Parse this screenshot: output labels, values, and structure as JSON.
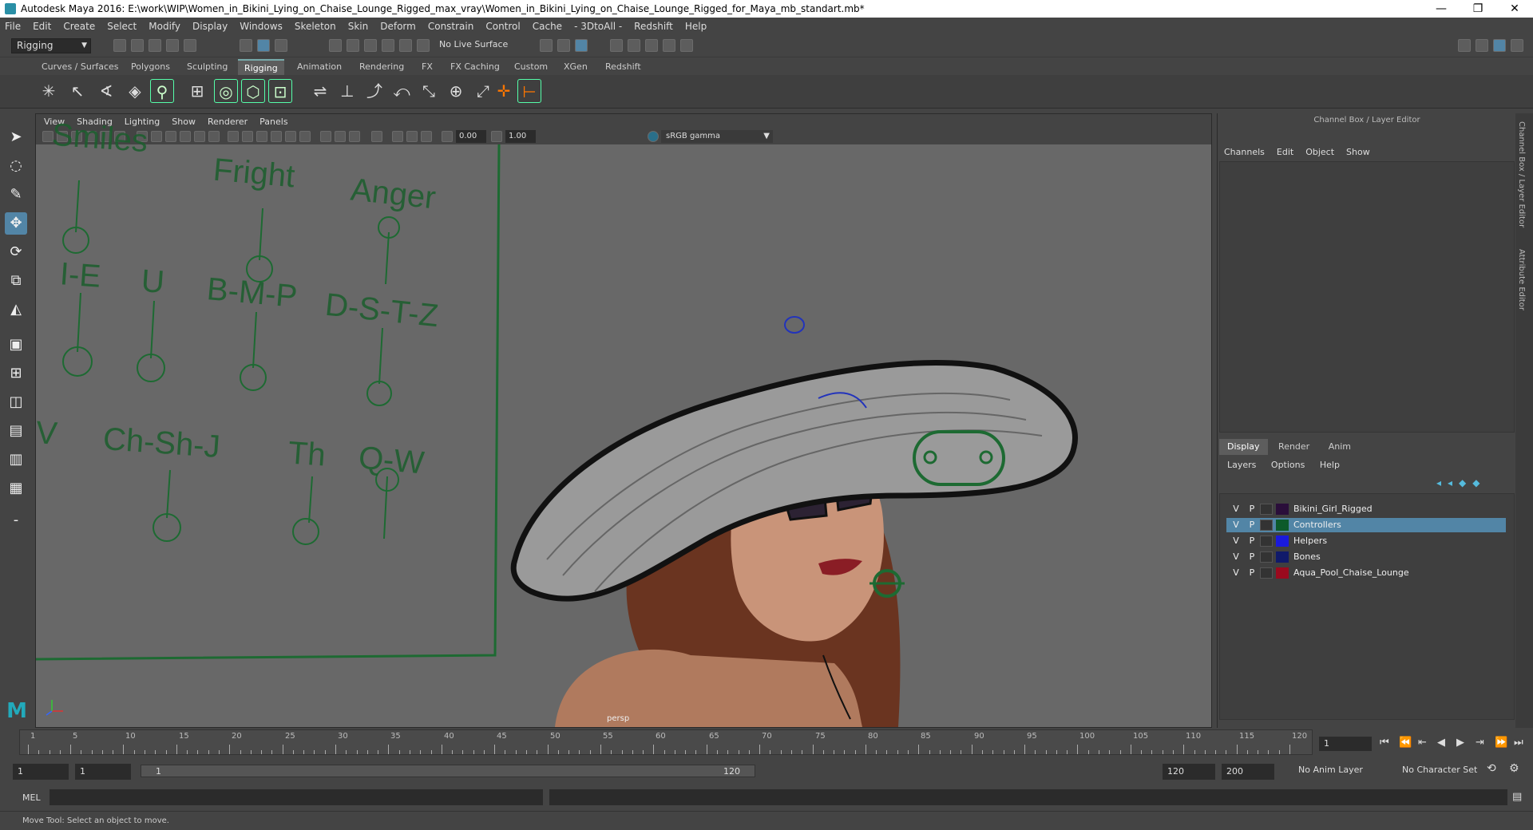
{
  "window": {
    "title": "Autodesk Maya 2016: E:\\work\\WIP\\Women_in_Bikini_Lying_on_Chaise_Lounge_Rigged_max_vray\\Women_in_Bikini_Lying_on_Chaise_Lounge_Rigged_for_Maya_mb_standart.mb*",
    "minimize": "—",
    "restore": "❐",
    "close": "✕"
  },
  "menubar": [
    "File",
    "Edit",
    "Create",
    "Select",
    "Modify",
    "Display",
    "Windows",
    "Skeleton",
    "Skin",
    "Deform",
    "Constrain",
    "Control",
    "Cache",
    "- 3DtoAll -",
    "Redshift",
    "Help"
  ],
  "statusline": {
    "mode": "Rigging",
    "live_surface": "No Live Surface"
  },
  "shelf_tabs": [
    "Curves / Surfaces",
    "Polygons",
    "Sculpting",
    "Rigging",
    "Animation",
    "Rendering",
    "FX",
    "FX Caching",
    "Custom",
    "XGen",
    "Redshift"
  ],
  "shelf_active": "Rigging",
  "viewport": {
    "menu": [
      "View",
      "Shading",
      "Lighting",
      "Show",
      "Renderer",
      "Panels"
    ],
    "exposure": "0.00",
    "gamma": "1.00",
    "colorspace": "sRGB gamma",
    "camera": "persp",
    "face_labels": [
      "Smiles",
      "Fright",
      "Anger",
      "I-E",
      "U",
      "B-M-P",
      "D-S-T-Z",
      "V",
      "Ch-Sh-J",
      "Th",
      "Q-W"
    ]
  },
  "channel_box": {
    "title": "Channel Box / Layer Editor",
    "menu": [
      "Channels",
      "Edit",
      "Object",
      "Show"
    ]
  },
  "layer_editor": {
    "tabs": [
      "Display",
      "Render",
      "Anim"
    ],
    "menu": [
      "Layers",
      "Options",
      "Help"
    ],
    "layers": [
      {
        "v": "V",
        "p": "P",
        "name": "Bikini_Girl_Rigged",
        "color": "#2a0e3a"
      },
      {
        "v": "V",
        "p": "P",
        "name": "Controllers",
        "color": "#0d5a2a",
        "selected": true
      },
      {
        "v": "V",
        "p": "P",
        "name": "Helpers",
        "color": "#1a1adc"
      },
      {
        "v": "V",
        "p": "P",
        "name": "Bones",
        "color": "#101a6a"
      },
      {
        "v": "V",
        "p": "P",
        "name": "Aqua_Pool_Chaise_Lounge",
        "color": "#9a0a1e"
      }
    ]
  },
  "side_tabs": [
    "Channel Box / Layer Editor",
    "Attribute Editor"
  ],
  "timeline": {
    "ticks": [
      1,
      5,
      10,
      15,
      20,
      25,
      30,
      35,
      40,
      45,
      50,
      55,
      60,
      65,
      70,
      75,
      80,
      85,
      90,
      95,
      100,
      105,
      110,
      115,
      120
    ],
    "current_frame": "1"
  },
  "range": {
    "start": "1",
    "anim_start": "1",
    "range_start": "1",
    "range_end": "120",
    "end": "120",
    "anim_end": "200",
    "anim_layer": "No Anim Layer",
    "char_set": "No Character Set"
  },
  "command": {
    "label": "MEL"
  },
  "help_line": "Move Tool: Select an object to move."
}
